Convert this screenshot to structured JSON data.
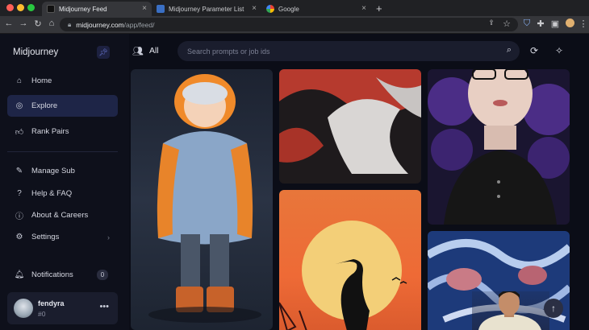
{
  "browser": {
    "tabs": [
      {
        "title": "Midjourney Feed",
        "active": true
      },
      {
        "title": "Midjourney Parameter List",
        "active": false
      },
      {
        "title": "Google",
        "active": false
      }
    ],
    "address": {
      "host": "midjourney.com",
      "path": "/app/feed/"
    }
  },
  "sidebar": {
    "brand": "Midjourney",
    "items": [
      {
        "label": "Home",
        "icon": "home-icon"
      },
      {
        "label": "Explore",
        "icon": "compass-icon",
        "active": true
      },
      {
        "label": "Rank Pairs",
        "icon": "thumbs-up-icon"
      },
      {
        "label": "Manage Sub",
        "icon": "edit-icon"
      },
      {
        "label": "Help & FAQ",
        "icon": "help-icon"
      },
      {
        "label": "About & Careers",
        "icon": "info-icon"
      },
      {
        "label": "Settings",
        "icon": "gear-icon"
      }
    ],
    "notifications": {
      "label": "Notifications",
      "count": "0"
    },
    "user": {
      "name": "fendyra",
      "id": "#0"
    }
  },
  "header": {
    "filter_label": "All",
    "search_placeholder": "Search prompts or job ids"
  },
  "colors": {
    "accent_active": "#1e2547",
    "background": "#0b0d17"
  }
}
